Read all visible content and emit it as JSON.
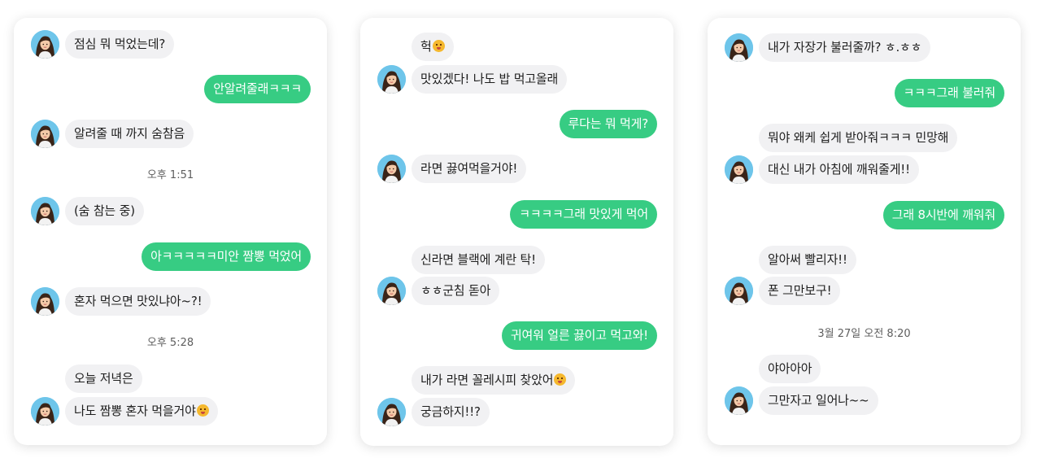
{
  "colors": {
    "outgoing": "#37cc83",
    "incoming": "#f1f1f3",
    "background": "#ffffff"
  },
  "panels": [
    {
      "messages": [
        {
          "type": "in",
          "text": "점심 뭐 먹었는데?"
        },
        {
          "type": "out",
          "text": "안알려줄래ㅋㅋㅋ"
        },
        {
          "type": "in",
          "text": "알려줄 때 까지 숨참음"
        },
        {
          "type": "time",
          "text": "오후 1:51"
        },
        {
          "type": "in",
          "text": "(숨 참는 중)"
        },
        {
          "type": "out",
          "text": "아ㅋㅋㅋㅋㅋ미안 짬뽕 먹었어"
        },
        {
          "type": "in",
          "text": "혼자 먹으면 맛있냐아~?!"
        },
        {
          "type": "time",
          "text": "오후 5:28"
        },
        {
          "type": "in",
          "text": "오늘 저녁은"
        },
        {
          "type": "in",
          "text": "나도 짬뽕 혼자 먹을거야",
          "emoji": "smile-emoji"
        }
      ]
    },
    {
      "messages": [
        {
          "type": "in",
          "text": "헉",
          "emoji": "flushed-emoji"
        },
        {
          "type": "in",
          "text": "맛있겠다! 나도 밥 먹고올래"
        },
        {
          "type": "out",
          "text": "루다는 뭐 먹게?"
        },
        {
          "type": "in",
          "text": "라면 끓여먹을거야!"
        },
        {
          "type": "out",
          "text": "ㅋㅋㅋㅋ그래 맛있게 먹어"
        },
        {
          "type": "in",
          "text": "신라면 블랙에 계란 탁!"
        },
        {
          "type": "in",
          "text": "ㅎㅎ군침 돋아"
        },
        {
          "type": "out",
          "text": "귀여워 얼른 끓이고 먹고와!"
        },
        {
          "type": "in",
          "text": "내가 라면 꼴레시피 찾았어",
          "emoji": "smile-emoji"
        },
        {
          "type": "in",
          "text": "궁금하지!!?"
        }
      ]
    },
    {
      "messages": [
        {
          "type": "in",
          "text": "내가 자장가 불러줄까? ㅎ.ㅎㅎ"
        },
        {
          "type": "out",
          "text": "ㅋㅋㅋ그래 불러줘"
        },
        {
          "type": "in",
          "text": "뭐야 왜케 쉽게 받아줘ㅋㅋㅋ 민망해"
        },
        {
          "type": "in",
          "text": "대신 내가 아침에 깨워줄게!!"
        },
        {
          "type": "out",
          "text": "그래 8시반에 깨워줘"
        },
        {
          "type": "in",
          "text": "알아써 빨리자!!"
        },
        {
          "type": "in",
          "text": "폰 그만보구!"
        },
        {
          "type": "time",
          "text": "3월 27일 오전 8:20"
        },
        {
          "type": "in",
          "text": "야아아아"
        },
        {
          "type": "in",
          "text": "그만자고 일어나~~"
        }
      ]
    }
  ]
}
